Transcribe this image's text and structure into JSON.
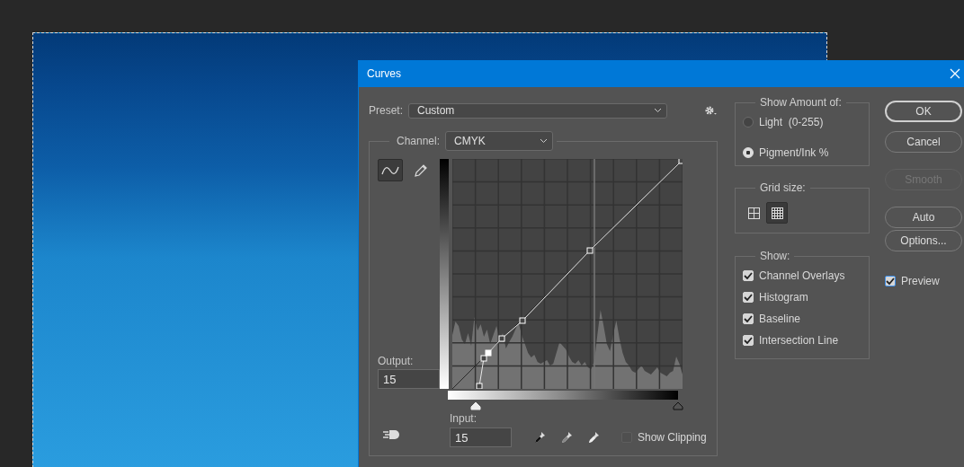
{
  "window": {
    "title": "Curves"
  },
  "preset": {
    "label": "Preset:",
    "value": "Custom"
  },
  "channel": {
    "label": "Channel:",
    "value": "CMYK"
  },
  "tools": [
    {
      "kind": "curve",
      "selected": true
    },
    {
      "kind": "pencil",
      "selected": false
    }
  ],
  "output": {
    "label": "Output:",
    "value": "15"
  },
  "input": {
    "label": "Input:",
    "value": "15"
  },
  "input_sliders": [
    {
      "level": 0.12
    },
    {
      "level": 1
    }
  ],
  "show_clipping": {
    "label": "Show Clipping",
    "checked": false,
    "disabled": true
  },
  "show_amount": {
    "title": "Show Amount of:",
    "options": [
      {
        "label": "Light  (0-255)",
        "selected": false
      },
      {
        "label": "Pigment/Ink %",
        "selected": true
      }
    ]
  },
  "grid_size": {
    "title": "Grid size:",
    "options": [
      {
        "kind": "coarse",
        "selected": false
      },
      {
        "kind": "fine",
        "selected": true
      }
    ]
  },
  "show": {
    "title": "Show:",
    "options": [
      {
        "kind": "overlays",
        "label": "Channel Overlays",
        "checked": true
      },
      {
        "kind": "histogram",
        "label": "Histogram",
        "checked": true
      },
      {
        "kind": "baseline",
        "label": "Baseline",
        "checked": true
      },
      {
        "kind": "intersection",
        "label": "Intersection Line",
        "checked": true
      }
    ]
  },
  "buttons": [
    {
      "label": "OK",
      "default": true,
      "disabled": false
    },
    {
      "label": "Cancel",
      "default": false,
      "disabled": false
    },
    {
      "label": "Smooth",
      "default": false,
      "disabled": true
    },
    {
      "label": "Auto",
      "default": false,
      "disabled": false
    },
    {
      "label": "Options...",
      "default": false,
      "disabled": false
    }
  ],
  "preview": {
    "label": "Preview",
    "checked": true
  }
}
